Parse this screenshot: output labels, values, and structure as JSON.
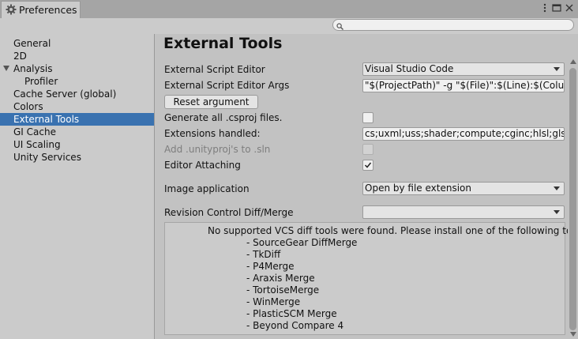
{
  "window": {
    "tab_title": "Preferences",
    "tab_icon": "gear-icon",
    "controls": [
      "more-options-icon",
      "maximize-icon",
      "close-icon"
    ]
  },
  "search": {
    "value": "",
    "placeholder": ""
  },
  "sidebar": {
    "items": [
      {
        "label": "General",
        "selected": false,
        "expandable": false,
        "child": false
      },
      {
        "label": "2D",
        "selected": false,
        "expandable": false,
        "child": false
      },
      {
        "label": "Analysis",
        "selected": false,
        "expandable": true,
        "child": false
      },
      {
        "label": "Profiler",
        "selected": false,
        "expandable": false,
        "child": true
      },
      {
        "label": "Cache Server (global)",
        "selected": false,
        "expandable": false,
        "child": false
      },
      {
        "label": "Colors",
        "selected": false,
        "expandable": false,
        "child": false
      },
      {
        "label": "External Tools",
        "selected": true,
        "expandable": false,
        "child": false
      },
      {
        "label": "GI Cache",
        "selected": false,
        "expandable": false,
        "child": false
      },
      {
        "label": "UI Scaling",
        "selected": false,
        "expandable": false,
        "child": false
      },
      {
        "label": "Unity Services",
        "selected": false,
        "expandable": false,
        "child": false
      }
    ]
  },
  "main": {
    "title": "External Tools",
    "script_editor": {
      "label": "External Script Editor",
      "value": "Visual Studio Code"
    },
    "script_editor_args": {
      "label": "External Script Editor Args",
      "value": "\"$(ProjectPath)\" -g \"$(File)\":$(Line):$(Column)"
    },
    "reset_button": "Reset argument",
    "generate_csproj": {
      "label": "Generate all .csproj files.",
      "checked": false
    },
    "extensions_handled": {
      "label": "Extensions handled:",
      "value": "cs;uxml;uss;shader;compute;cginc;hlsl;glslinc"
    },
    "add_unityproj": {
      "label": "Add .unityproj's to .sln",
      "checked": false,
      "disabled": true
    },
    "editor_attaching": {
      "label": "Editor Attaching",
      "checked": true
    },
    "image_application": {
      "label": "Image application",
      "value": "Open by file extension"
    },
    "revision_control": {
      "label": "Revision Control Diff/Merge",
      "value": ""
    },
    "help": {
      "message": "No supported VCS diff tools were found. Please install one of the following tools:",
      "tools": [
        "- SourceGear DiffMerge",
        "- TkDiff",
        "- P4Merge",
        "- Araxis Merge",
        "- TortoiseMerge",
        "- WinMerge",
        "- PlasticSCM Merge",
        "- Beyond Compare 4"
      ]
    }
  },
  "colors": {
    "selection": "#3a72b0",
    "background": "#c2c2c2",
    "panel": "#cbcbcb"
  }
}
